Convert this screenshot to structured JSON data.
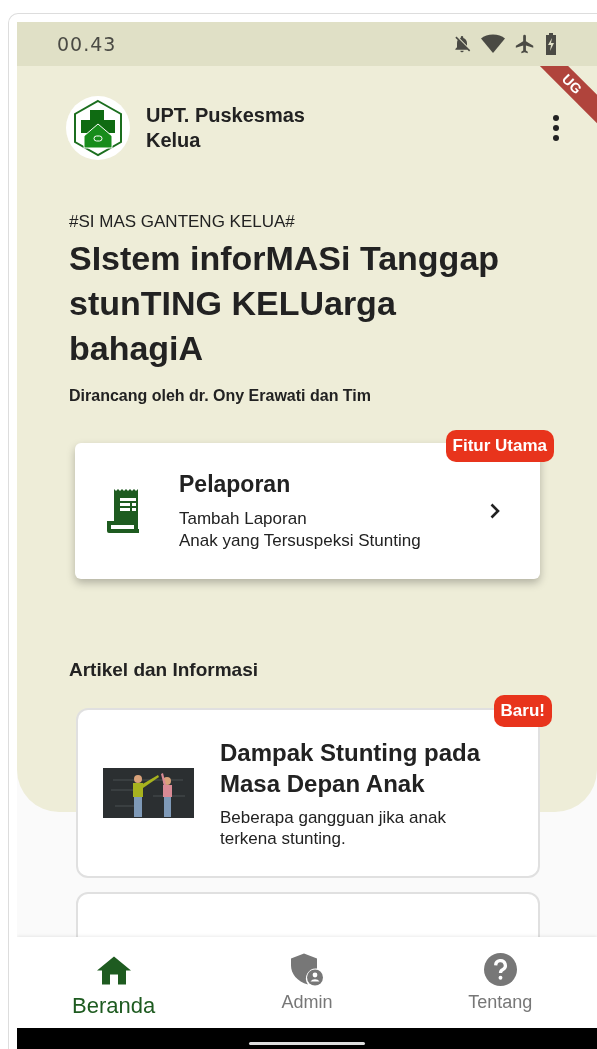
{
  "status_bar": {
    "time": "00.43"
  },
  "debug_banner": "UG",
  "header": {
    "org_name": "UPT. Puskesmas Kelua"
  },
  "tagline": "#SI MAS GANTENG KELUA#",
  "headline": "SIstem inforMASi Tanggap stunTING KELUarga bahagiA",
  "credit": "Dirancang oleh dr. Ony Erawati dan Tim",
  "feature_card": {
    "badge": "Fitur Utama",
    "title": "Pelaporan",
    "lines": [
      "Tambah Laporan",
      "Anak yang Tersuspeksi Stunting"
    ]
  },
  "articles_section": {
    "title": "Artikel dan Informasi",
    "articles": [
      {
        "kind": "full",
        "badge": "Baru!",
        "title": "Dampak Stunting pada Masa Depan Anak",
        "summary": "Beberapa gangguan jika anak terkena stunting."
      },
      {
        "kind": "covered"
      }
    ]
  },
  "bottom_nav": [
    {
      "label": "Beranda",
      "selected": true
    },
    {
      "label": "Admin",
      "selected": false
    },
    {
      "label": "Tentang",
      "selected": false
    }
  ]
}
